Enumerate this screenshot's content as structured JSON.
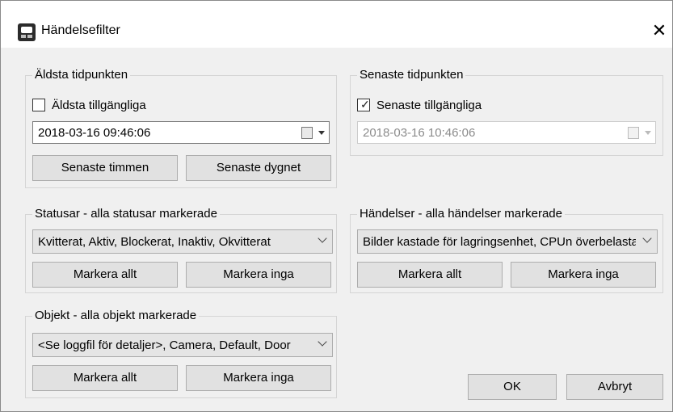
{
  "window": {
    "title": "Händelsefilter",
    "close_glyph": "✕"
  },
  "oldest": {
    "legend": "Äldsta tidpunkten",
    "checkbox_label": "Äldsta tillgängliga",
    "checked": false,
    "value": "2018-03-16 09:46:06",
    "btn_hour": "Senaste timmen",
    "btn_day": "Senaste dygnet"
  },
  "latest": {
    "legend": "Senaste tidpunkten",
    "checkbox_label": "Senaste tillgängliga",
    "checked": true,
    "check_glyph": "✓",
    "value": "2018-03-16 10:46:06"
  },
  "statuses": {
    "legend": "Statusar - alla statusar markerade",
    "selected": "Kvitterat, Aktiv, Blockerat, Inaktiv, Okvitterat",
    "select_all": "Markera allt",
    "select_none": "Markera inga"
  },
  "events": {
    "legend": "Händelser - alla händelser markerade",
    "selected": "Bilder kastade för lagringsenhet, CPUn överbelastad",
    "select_all": "Markera allt",
    "select_none": "Markera inga"
  },
  "objects": {
    "legend": "Objekt - alla objekt markerade",
    "selected": "<Se loggfil för detaljer>, Camera, Default, Door",
    "select_all": "Markera allt",
    "select_none": "Markera inga"
  },
  "footer": {
    "ok": "OK",
    "cancel": "Avbryt"
  }
}
